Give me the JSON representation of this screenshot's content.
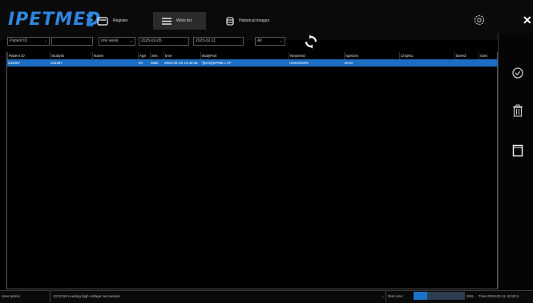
{
  "app": {
    "logo_text": "IPETMED"
  },
  "nav": {
    "register": "Register",
    "worklist": "Work list",
    "historical": "Historical images"
  },
  "filters": {
    "field": "Patient ID",
    "search_value": "",
    "period": "one week",
    "date_from": "2025-02-05",
    "date_to": "2025-02-11",
    "status": "All"
  },
  "table": {
    "columns": [
      "Patient ID",
      "StudyID",
      "Name",
      "Age",
      "Sex",
      "time",
      "BodyPart",
      "Neutered",
      "Species",
      "ChipNo.",
      "Breed",
      "Own"
    ],
    "rows": [
      [
        "232367",
        "232367",
        "",
        "0Y",
        "Male",
        "2025-02-10 10:49:46",
        "\"[DOG]SPINE LAT\"",
        "UNKNOWN",
        "DOG",
        "",
        "",
        ""
      ]
    ]
  },
  "status": {
    "user": "User:admin",
    "message": "10:53:59 Loading high voltage succeeded",
    "disk_label": "Disk size:",
    "disk_percent": "26%",
    "disk_fraction": 0.26,
    "time": "Time:2025-02-11 10:50:5"
  },
  "colors": {
    "accent": "#1b6ec2",
    "logo": "#2e86de"
  }
}
